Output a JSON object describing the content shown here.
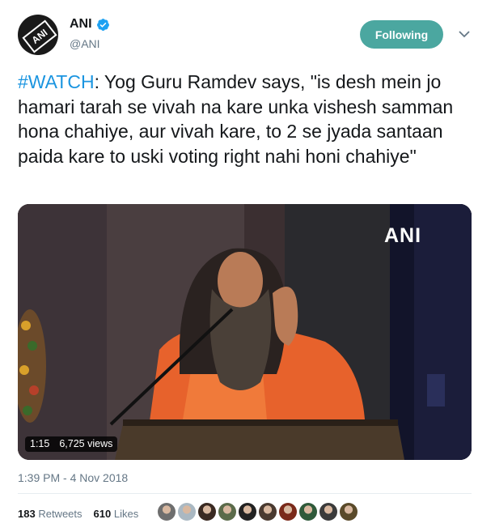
{
  "account": {
    "name": "ANI",
    "handle": "@ANI",
    "avatar_text": "ANI",
    "verified_icon": "verified-badge-icon"
  },
  "follow_button": {
    "label": "Following"
  },
  "tweet": {
    "hashtag": "#WATCH",
    "text": ": Yog Guru Ramdev says, \"is desh mein jo hamari tarah se vivah na kare unka vishesh samman hona chahiye, aur vivah kare, to 2 se jyada santaan paida kare to uski voting right nahi honi chahiye\""
  },
  "video": {
    "watermark": "ANI",
    "duration": "1:15",
    "views": "6,725 views"
  },
  "timestamp": "1:39 PM - 4 Nov 2018",
  "stats": {
    "retweets_count": "183",
    "retweets_label": "Retweets",
    "likes_count": "610",
    "likes_label": "Likes"
  },
  "likers": [
    {
      "icon": "liker-avatar-1",
      "color": "#6e6e6e"
    },
    {
      "icon": "liker-avatar-2",
      "color": "#aab8c2"
    },
    {
      "icon": "liker-avatar-3",
      "color": "#3a2a22"
    },
    {
      "icon": "liker-avatar-4",
      "color": "#5b6b4a"
    },
    {
      "icon": "liker-avatar-5",
      "color": "#222222"
    },
    {
      "icon": "liker-avatar-6",
      "color": "#4a3a30"
    },
    {
      "icon": "liker-avatar-7",
      "color": "#7a2a1a"
    },
    {
      "icon": "liker-avatar-8",
      "color": "#2f5a3a"
    },
    {
      "icon": "liker-avatar-9",
      "color": "#3b3b3b"
    },
    {
      "icon": "liker-avatar-10",
      "color": "#5a4a2a"
    }
  ],
  "colors": {
    "link": "#1b95e0",
    "follow_button_bg": "#4ba7a0",
    "secondary_text": "#657786"
  }
}
